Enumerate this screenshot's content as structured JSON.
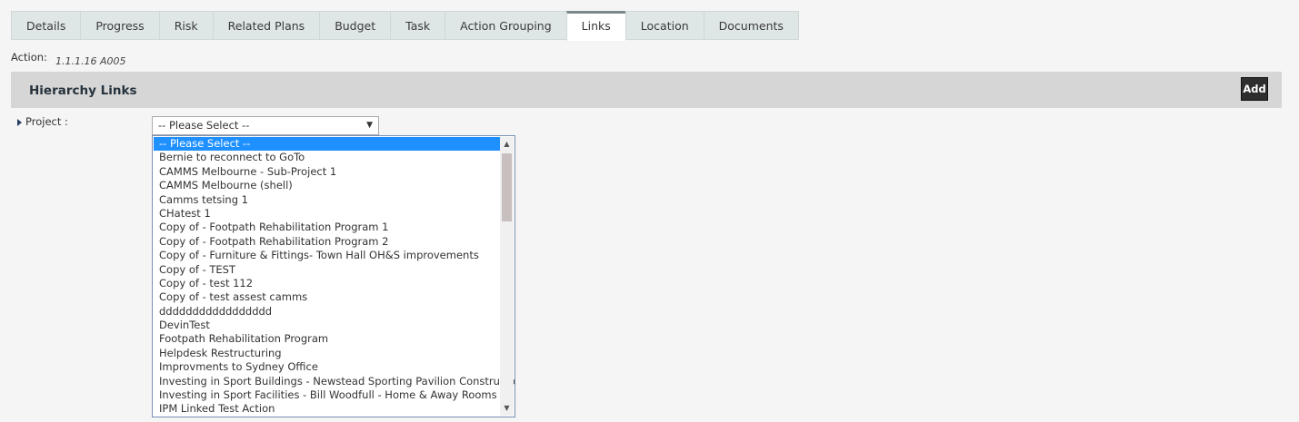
{
  "tabs": [
    {
      "label": "Details"
    },
    {
      "label": "Progress"
    },
    {
      "label": "Risk"
    },
    {
      "label": "Related Plans"
    },
    {
      "label": "Budget"
    },
    {
      "label": "Task"
    },
    {
      "label": "Action Grouping"
    },
    {
      "label": "Links",
      "active": true
    },
    {
      "label": "Location"
    },
    {
      "label": "Documents"
    }
  ],
  "action": {
    "label": "Action:",
    "value": "1.1.1.16 A005"
  },
  "section": {
    "title": "Hierarchy Links",
    "add_label": "Add"
  },
  "project": {
    "label": "Project :",
    "selected": "-- Please Select --",
    "options": [
      "-- Please Select --",
      "Bernie to reconnect to GoTo",
      "CAMMS Melbourne - Sub-Project 1",
      "CAMMS Melbourne (shell)",
      "Camms tetsing 1",
      "CHatest 1",
      "Copy of - Footpath Rehabilitation Program 1",
      "Copy of - Footpath Rehabilitation Program 2",
      "Copy of - Furniture & Fittings- Town Hall OH&S improvements",
      "Copy of - TEST",
      "Copy of - test 112",
      "Copy of - test assest camms",
      "ddddddddddddddddd",
      "DevinTest",
      "Footpath Rehabilitation Program",
      "Helpdesk Restructuring",
      "Improvments to Sydney Office",
      "Investing in Sport Buildings - Newstead Sporting Pavilion Construction",
      "Investing in Sport Facilities - Bill Woodfull - Home & Away Rooms",
      "IPM Linked Test Action"
    ]
  },
  "icons": {
    "dropdown": "chevron-down-icon",
    "expand": "caret-right-icon"
  }
}
